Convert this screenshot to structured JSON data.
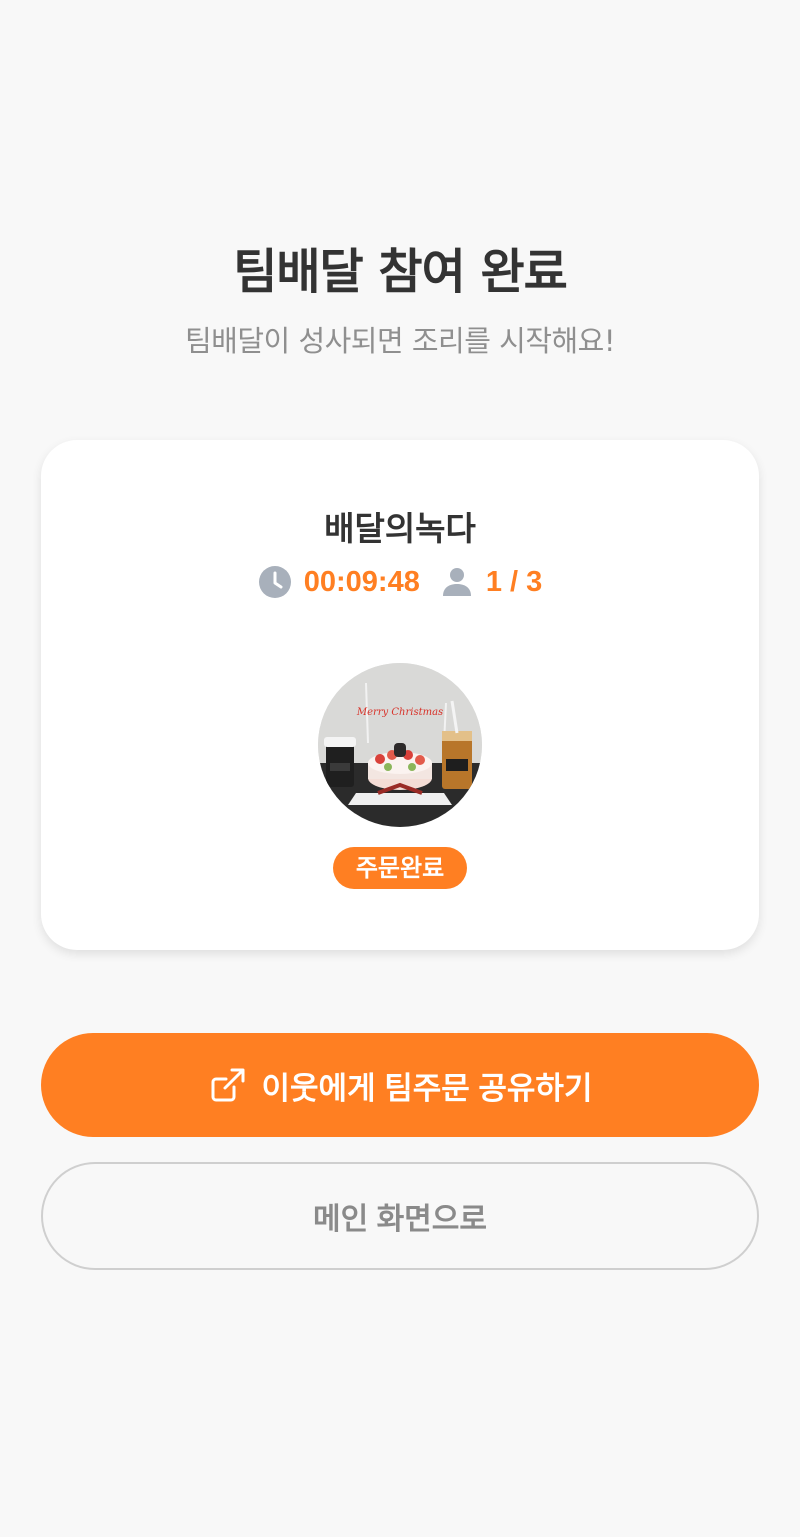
{
  "header": {
    "title": "팀배달 참여 완료",
    "subtitle": "팀배달이 성사되면 조리를 시작해요!"
  },
  "card": {
    "store_name": "배달의녹다",
    "timer": "00:09:48",
    "participants": "1 / 3",
    "photo_topper_text": "Merry Christmas",
    "status_badge": "주문완료"
  },
  "buttons": {
    "share_label": "이웃에게 팀주문 공유하기",
    "main_label": "메인 화면으로"
  },
  "colors": {
    "accent": "#ff7f22",
    "background": "#f8f8f8",
    "title": "#333333",
    "subtitle": "#8f8f8f",
    "icon_gray": "#a8b0bb"
  },
  "icons": {
    "timer": "clock-icon",
    "participants": "person-icon",
    "share": "external-link-icon"
  }
}
